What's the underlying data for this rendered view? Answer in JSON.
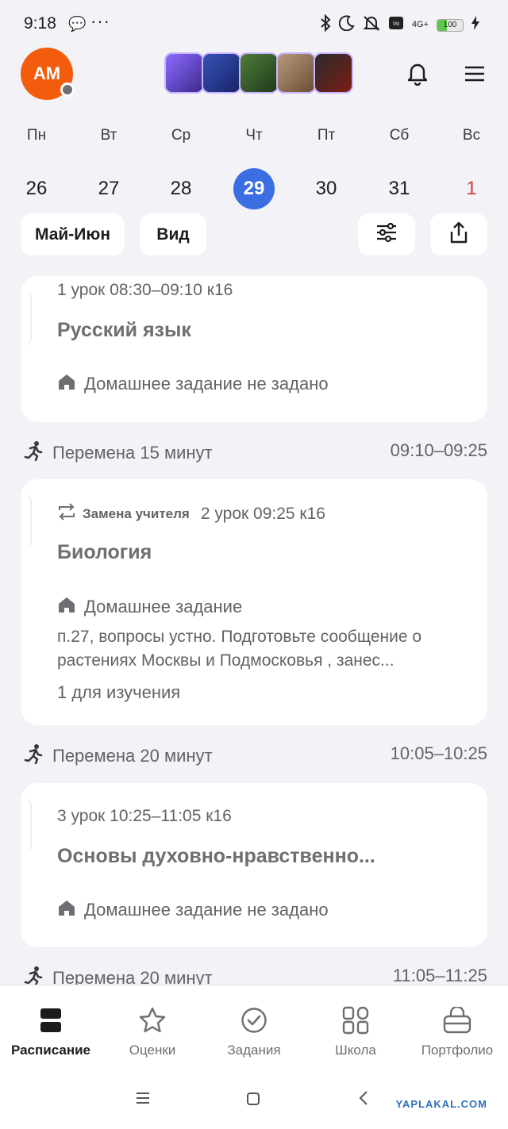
{
  "status_bar": {
    "time": "9:18",
    "network": "4G+",
    "battery": "100"
  },
  "header": {
    "avatar_initials": "АМ"
  },
  "week": {
    "days": [
      {
        "name": "Пн",
        "date": "26"
      },
      {
        "name": "Вт",
        "date": "27"
      },
      {
        "name": "Ср",
        "date": "28"
      },
      {
        "name": "Чт",
        "date": "29",
        "selected": true
      },
      {
        "name": "Пт",
        "date": "30"
      },
      {
        "name": "Сб",
        "date": "31"
      },
      {
        "name": "Вс",
        "date": "1",
        "holiday": true
      }
    ]
  },
  "controls": {
    "period": "Май-Июн",
    "view": "Вид"
  },
  "lessons": [
    {
      "meta": "1 урок  08:30–09:10  к16",
      "subject": "Русский язык",
      "homework_label": "Домашнее задание не задано"
    },
    {
      "substitution": "Замена учителя",
      "meta": "2 урок  09:25  к16",
      "subject": "Биология",
      "homework_label": "Домашнее задание",
      "homework_text": "п.27, вопросы устно. Подготовьте сообщение о растениях Москвы и Подмосковья , занес...",
      "materials": "1 для изучения"
    },
    {
      "meta": "3 урок  10:25–11:05  к16",
      "subject": "Основы духовно-нравственно...",
      "homework_label": "Домашнее задание не задано"
    }
  ],
  "breaks": [
    {
      "label": "Перемена 15 минут",
      "time": "09:10–09:25"
    },
    {
      "label": "Перемена 20 минут",
      "time": "10:05–10:25"
    },
    {
      "label": "Перемена 20 минут",
      "time": "11:05–11:25"
    }
  ],
  "nav": [
    {
      "label": "Расписание",
      "icon": "schedule-icon",
      "active": true
    },
    {
      "label": "Оценки",
      "icon": "star-icon"
    },
    {
      "label": "Задания",
      "icon": "check-circle-icon"
    },
    {
      "label": "Школа",
      "icon": "grid-icon"
    },
    {
      "label": "Портфолио",
      "icon": "briefcase-icon"
    }
  ],
  "watermark": "YAPLAKAL.COM",
  "colors": {
    "accent": "#3b6de3",
    "avatar": "#f25c0c",
    "sunday": "#d63a3a",
    "background": "#f2f2f7"
  }
}
